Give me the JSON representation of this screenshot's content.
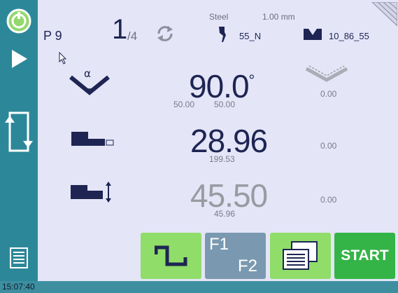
{
  "header": {
    "program_label": "P 9",
    "bend_current": "1",
    "bend_total": "/4",
    "material": "Steel",
    "thickness": "1.00 mm",
    "punch_name": "55_N",
    "die_name": "10_86_55"
  },
  "rows": [
    {
      "name": "angle",
      "value": "90.0",
      "unit": "°",
      "sub_left": "50.00",
      "sub_right": "50.00",
      "right_value": "0.00"
    },
    {
      "name": "backgauge-x",
      "value": "28.96",
      "sub": "199.53",
      "right_value": "0.00"
    },
    {
      "name": "backgauge-r",
      "value": "45.50",
      "sub": "45.96",
      "right_value": "0.00"
    }
  ],
  "buttons": {
    "f1_label": "F1",
    "f2_label": "F2",
    "start_label": "START"
  },
  "footer": {
    "time": "15:07:40"
  },
  "colors": {
    "sidebar": "#2c8899",
    "panel": "#e4e5f7",
    "dark_text": "#1e2553",
    "green_button": "#90dd69",
    "start_button": "#34b446",
    "f_button": "#7a99b0"
  },
  "icons": {
    "top_left": "power-ring-icon",
    "play": "play-icon",
    "loop": "bend-cycle-icon",
    "list": "list-icon",
    "refresh": "refresh-icon",
    "punch": "punch-tool-icon",
    "die": "die-tool-icon",
    "angle": "bend-angle-icon",
    "angle_right": "angle-correction-icon",
    "backgauge_x": "backgauge-x-icon",
    "backgauge_r": "backgauge-r-icon",
    "profile": "bend-profile-icon",
    "f_toggle": "function-toggle-icon",
    "notes": "documents-icon",
    "corner": "corner-fold-icon"
  }
}
